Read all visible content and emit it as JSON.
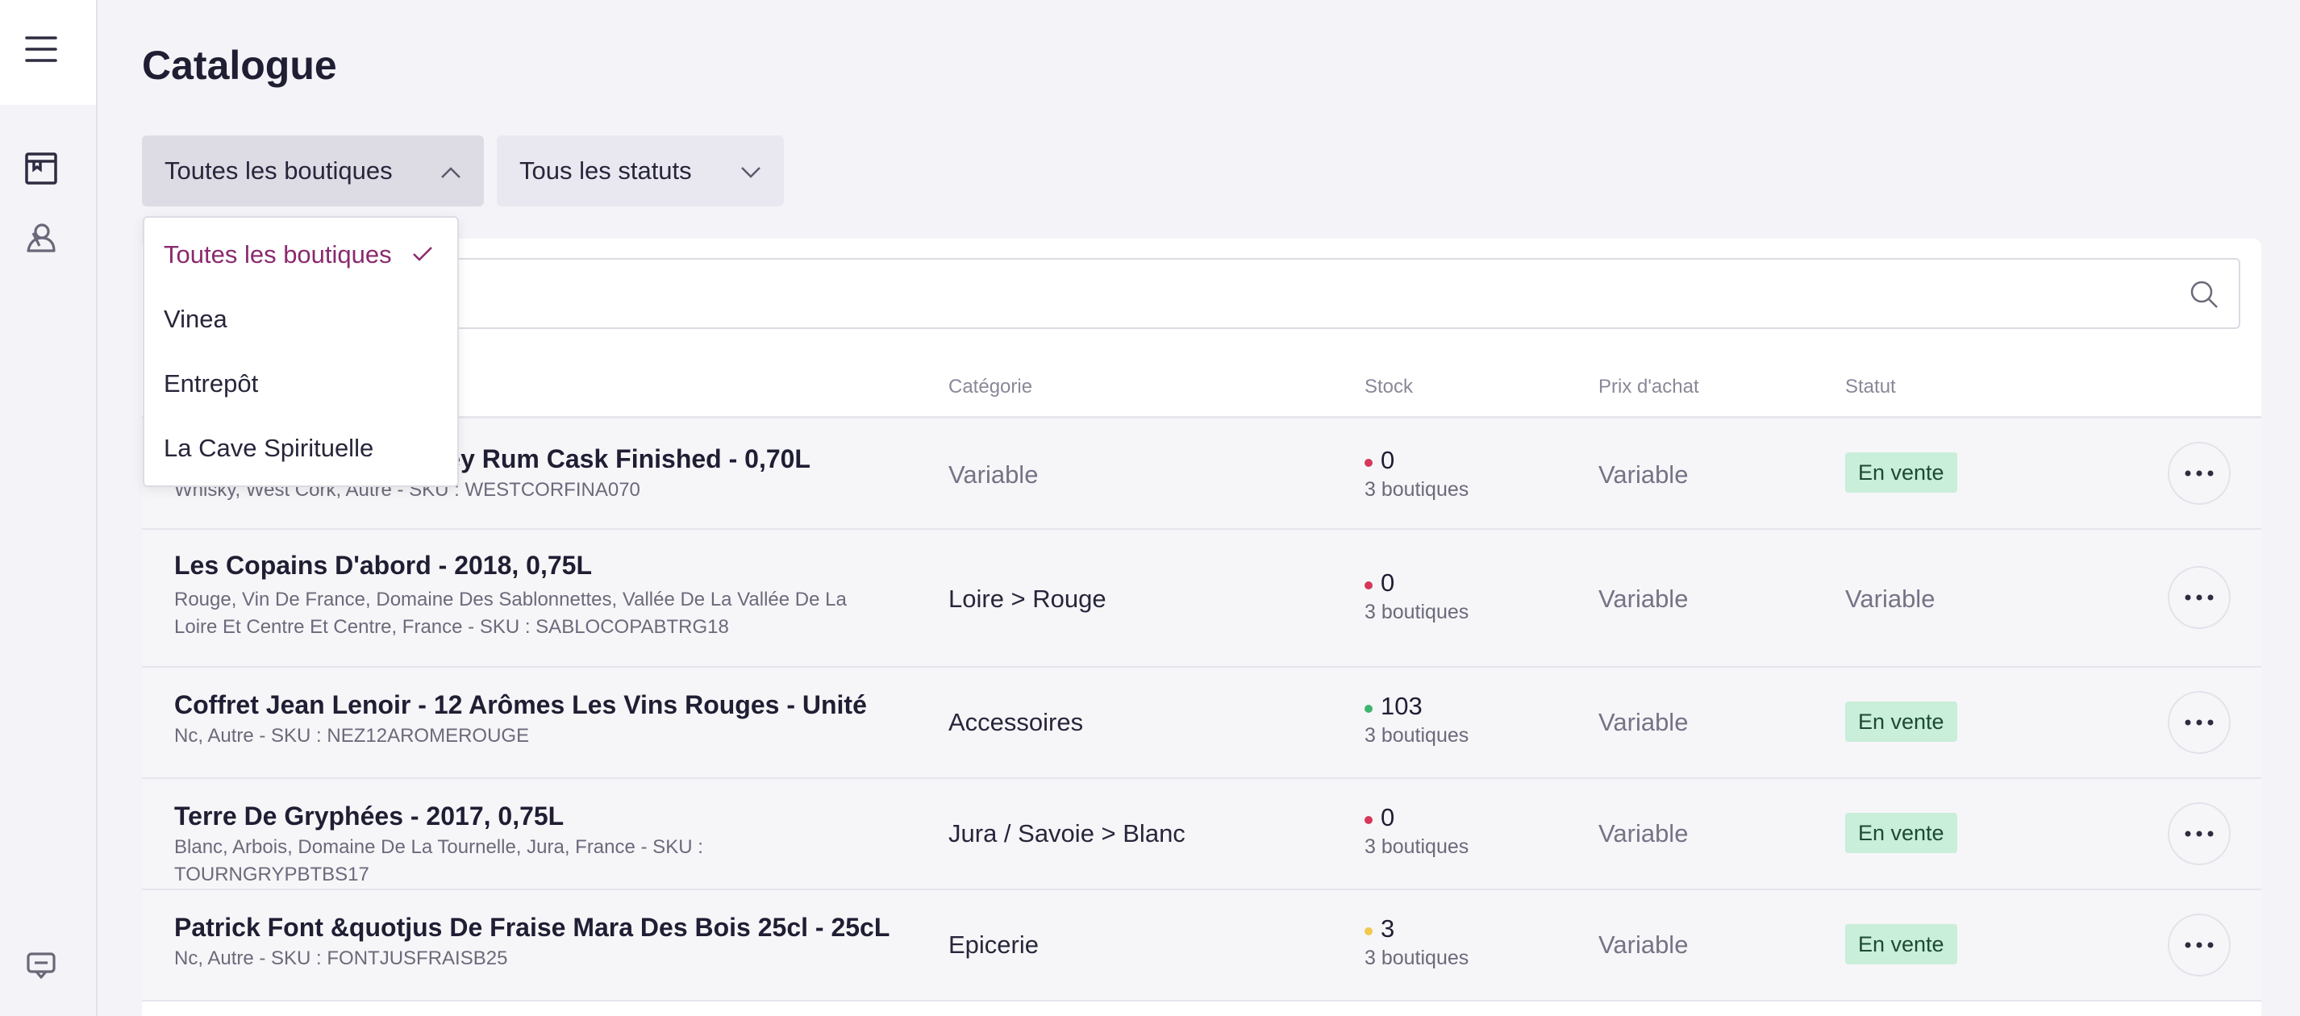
{
  "page": {
    "title": "Catalogue"
  },
  "filters": {
    "shop": {
      "label": "Toutes les boutiques",
      "open": true
    },
    "status": {
      "label": "Tous les statuts"
    }
  },
  "shop_dropdown": {
    "options": [
      {
        "label": "Toutes les boutiques",
        "selected": true
      },
      {
        "label": "Vinea"
      },
      {
        "label": "Entrepôt"
      },
      {
        "label": "La Cave Spirituelle"
      }
    ]
  },
  "search": {
    "placeholder": ""
  },
  "table": {
    "headers": {
      "category": "Catégorie",
      "stock": "Stock",
      "purchase_price": "Prix d'achat",
      "status": "Statut"
    },
    "rows": [
      {
        "name": "West Cork Irish Whiskey Rum Cask Finished - 0,70L",
        "desc": "Whisky, West Cork, Autre - SKU : WESTCORFINA070",
        "category": "Variable",
        "stock": "0",
        "stock_color": "#d6375a",
        "shops": "3 boutiques",
        "price": "Variable",
        "status": "En vente"
      },
      {
        "name": "Les Copains D'abord - 2018, 0,75L",
        "desc": "Rouge, Vin De France, Domaine Des Sablonnettes, Vallée De La Vallée De La Loire Et Centre Et Centre, France - SKU : SABLOCOPABTRG18",
        "category": "Loire > Rouge",
        "stock": "0",
        "stock_color": "#d6375a",
        "shops": "3 boutiques",
        "price": "Variable",
        "status": "Variable"
      },
      {
        "name": "Coffret Jean Lenoir - 12 Arômes Les Vins Rouges - Unité",
        "desc": "Nc, Autre - SKU : NEZ12AROMEROUGE",
        "category": "Accessoires",
        "stock": "103",
        "stock_color": "#3fb46f",
        "shops": "3 boutiques",
        "price": "Variable",
        "status": "En vente"
      },
      {
        "name": "Terre De Gryphées - 2017, 0,75L",
        "desc": "Blanc, Arbois, Domaine De La Tournelle, Jura, France - SKU : TOURNGRYPBTBS17",
        "category": "Jura / Savoie > Blanc",
        "stock": "0",
        "stock_color": "#d6375a",
        "shops": "3 boutiques",
        "price": "Variable",
        "status": "En vente"
      },
      {
        "name": "Patrick Font &quotjus De Fraise Mara Des Bois 25cl - 25cL",
        "desc": "Nc, Autre - SKU : FONTJUSFRAISB25",
        "category": "Epicerie",
        "stock": "3",
        "stock_color": "#f2c94c",
        "shops": "3 boutiques",
        "price": "Variable",
        "status": "En vente"
      }
    ]
  },
  "sidebar": {
    "icons": [
      "menu-icon",
      "catalogue-icon",
      "customers-icon",
      "chat-icon"
    ]
  },
  "colors": {
    "accent": "#8a2a6e",
    "badge_bg": "#c9eed9",
    "background": "#f4f3f8"
  }
}
